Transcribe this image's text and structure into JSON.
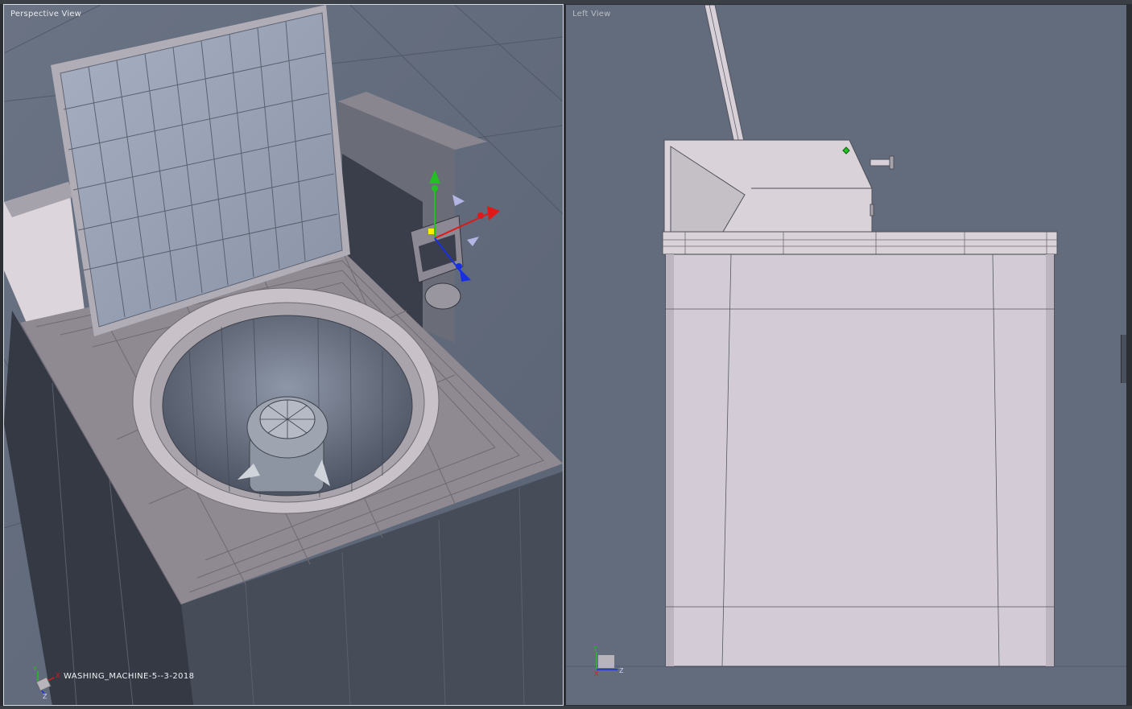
{
  "viewports": {
    "perspective": {
      "label": "Perspective View",
      "scene_name": "WASHING_MACHINE-5--3-2018"
    },
    "left": {
      "label": "Left View"
    }
  },
  "axes": {
    "x": "X",
    "y": "Y",
    "z": "Z"
  },
  "colors": {
    "viewport_bg": "#5f6878",
    "model_light": "#d7d0d8",
    "model_dark": "#3f4350",
    "gizmo_x": "#e01818",
    "gizmo_y": "#22c022",
    "gizmo_z": "#1830e0",
    "selected": "#ffee00"
  },
  "icons": [
    "axis-gizmo-icon",
    "move-gizmo-icon"
  ]
}
